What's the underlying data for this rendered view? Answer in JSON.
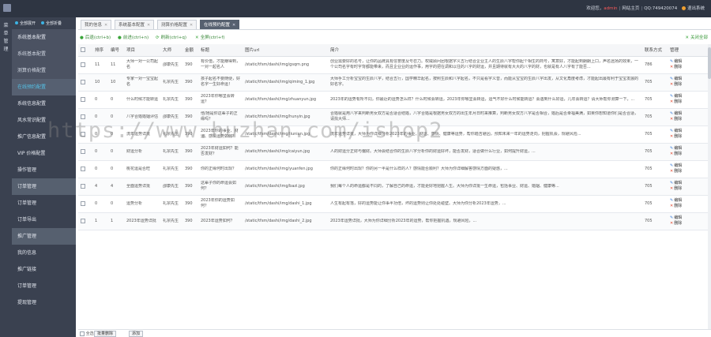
{
  "header": {
    "welcome": "欢迎您，",
    "username": "admin",
    "site_home": "网站主页",
    "qq": "QQ:749420074",
    "exit": "退出系统"
  },
  "left_strip": {
    "label": "菜单管理"
  },
  "sidebar": {
    "top_buttons": [
      "全部展开",
      "全部折叠"
    ],
    "items": [
      {
        "label": "系统基本配置",
        "state": "alt"
      },
      {
        "label": "系统基本配置",
        "state": "sub"
      },
      {
        "label": "测算价格配置",
        "state": "sub"
      },
      {
        "label": "在线预约配置",
        "state": "active"
      },
      {
        "label": "系统信息配置",
        "state": ""
      },
      {
        "label": "风水常识配置",
        "state": ""
      },
      {
        "label": "推广信息配置",
        "state": ""
      },
      {
        "label": "VIP 价格配置",
        "state": ""
      },
      {
        "label": "操作管理",
        "state": ""
      },
      {
        "label": "订单管理",
        "state": "head"
      },
      {
        "label": "订单管理",
        "state": ""
      },
      {
        "label": "订单导出",
        "state": ""
      },
      {
        "label": "推广管理",
        "state": "head"
      },
      {
        "label": "我的信息",
        "state": ""
      },
      {
        "label": "推广链接",
        "state": ""
      },
      {
        "label": "订单管理",
        "state": ""
      },
      {
        "label": "提现管理",
        "state": ""
      }
    ]
  },
  "tabs": [
    {
      "label": "我的信息"
    },
    {
      "label": "系统基本配置"
    },
    {
      "label": "测算价格配置"
    },
    {
      "label": "在线预约配置"
    }
  ],
  "toolbar": {
    "back": "后退(ctrl+b)",
    "forward": "前进(ctrl+n)",
    "refresh": "刷新(ctrl+q)",
    "fullscreen": "全屏(ctrl+f)",
    "close_all": "关闭全部"
  },
  "table": {
    "columns": [
      "",
      "排序",
      "编号",
      "项目",
      "大师",
      "金额",
      "标题",
      "图片url",
      "简介",
      "联系方式",
      "管理"
    ],
    "rows": [
      {
        "sort": "11",
        "id": "11",
        "project": "大师一对一公司起名",
        "master": "邵康先生",
        "amount": "390",
        "title": "有价值，才能赚得到，一对一起名人",
        "img": "/static/tfsm/dashi/img/gsqm.png",
        "intro": "创业需要好的名号，让你的品牌具有信誉度及号召力。权威顾问团根据字义五行结合企业主人的生辰八字帮你起个相生的商号，寓意好，才能起到朗朗上口，声名远扬的效果，一个公司名字有时字背都能带来，而且企业业的运作事，用字的把在调和以往的八字的财运，并且期待就有大大的八字的财，也就是有人八字有了能否...",
        "contact": "786",
        "edit": "编辑",
        "del": "删除"
      },
      {
        "sort": "10",
        "id": "10",
        "project": "专家一对一宝宝起名",
        "master": "礼宗先生",
        "amount": "390",
        "title": "孩子起名不要随便，好名字一生好命运！",
        "img": "/static/tfsm/dashi/img/qiming_1.jpg",
        "intro": "大师手工分析宝宝的生辰八字，结合五行，国学精华起名，按照生辰和八字起名，不只是看字义音，而能从宝宝的生辰八字出发，从文化角度考虑，才能起出最有利于宝宝发展的好名字。",
        "contact": "705",
        "edit": "编辑",
        "del": "删除"
      },
      {
        "sort": "0",
        "id": "0",
        "project": "什么时候才能转运",
        "master": "礼宗先生",
        "amount": "390",
        "title": "2023年你哪里会转运？",
        "img": "/static/tfsm/dashi/img/zhuanyun.jpg",
        "intro": "2023年的运势有所不同，你最近的运势怎么样？什么时候会转运，2023年你哪里会转运，运气不好什么时候能转运？会遇到什么好运，几年会转运？请大师帮你测算一下，...",
        "contact": "705",
        "edit": "编辑",
        "del": "删除"
      },
      {
        "sort": "0",
        "id": "0",
        "project": "八字合婚婚姻评估",
        "master": "邵康先生",
        "amount": "390",
        "title": "他/她是你这辈子的正缘吗？",
        "img": "/static/tfsm/dashi/img/hunyin.jpg",
        "intro": "合婚就是用八字来判断男女双方是否适合结婚，八字合婚是根据男女双方的出生年月日时来推算，判断男女双方八字是否相合，婚后是否幸福美满，如果你想知道你们是否合适，请找大师...",
        "contact": "705",
        "edit": "编辑",
        "del": "删除"
      },
      {
        "sort": "0",
        "id": "0",
        "project": "流年运势详批",
        "master": "礼宗先生",
        "amount": "390",
        "title": "2023年你的事业、财运、感情运势如何？",
        "img": "/static/tfsm/dashi/img/liunian.jpg",
        "intro": "流年运势详批，大师为你详细分析2023年的事业、财运、感情、健康等运势，帮你趋吉避凶，预知未来一年的运势走向，把握机会，规避风险...",
        "contact": "705",
        "edit": "编辑",
        "del": "删除"
      },
      {
        "sort": "0",
        "id": "0",
        "project": "财运分析",
        "master": "礼宗先生",
        "amount": "390",
        "title": "2023年财运如何？能否发财？",
        "img": "/static/tfsm/dashi/img/caiyun.jpg",
        "intro": "人的财运分正财与偏财。大师会结合你的生辰八字分析你的财运好坏，能否发财，适合做什么行业，如何提升财运，...",
        "contact": "705",
        "edit": "编辑",
        "del": "删除"
      },
      {
        "sort": "0",
        "id": "0",
        "project": "桃花运是否旺",
        "master": "礼宗先生",
        "amount": "390",
        "title": "你的正缘何时出现？",
        "img": "/static/tfsm/dashi/img/yuanfen.jpg",
        "intro": "你的正缘何时出现？你的另一半是什么样的人？感情能否顺利？大师为你详细解答感情方面的疑惑，...",
        "contact": "705",
        "edit": "编辑",
        "del": "删除"
      },
      {
        "sort": "4",
        "id": "4",
        "project": "全面运势详批",
        "master": "邵康先生",
        "amount": "390",
        "title": "这辈子你的命运会如何？",
        "img": "/static/tfsm/dashi/img/bazi.jpg",
        "intro": "我们每个人的命运都是不同的，了解自己的命运，才能更好地把握人生。大师为你详批一生命运，包括事业、财运、婚姻、健康等...",
        "contact": "705",
        "edit": "编辑",
        "del": "删除"
      },
      {
        "sort": "0",
        "id": "0",
        "project": "运势分析",
        "master": "礼宗先生",
        "amount": "390",
        "title": "2023年你的运势如何？",
        "img": "/static/tfsm/dashi/img/dashi_1.jpg",
        "intro": "人生有起有落，好的运势能让你事半功倍，坏的运势则让你处处碰壁。大师为你分析2023年运势，...",
        "contact": "705",
        "edit": "编辑",
        "del": "删除"
      },
      {
        "sort": "1",
        "id": "1",
        "project": "2023年运势详批",
        "master": "礼宗先生",
        "amount": "390",
        "title": "2023年运势如何？",
        "img": "/static/tfsm/dashi/img/dashi_2.jpg",
        "intro": "2023年运势详批，大师为你详细分析2023年的运势，帮你把握机遇，规避风险，...",
        "contact": "705",
        "edit": "编辑",
        "del": "删除"
      }
    ]
  },
  "footer": {
    "select_all": "全选",
    "batch_delete": "批量删除",
    "add": "添加"
  },
  "watermark": "https://www.huzhan.com/ishop2"
}
